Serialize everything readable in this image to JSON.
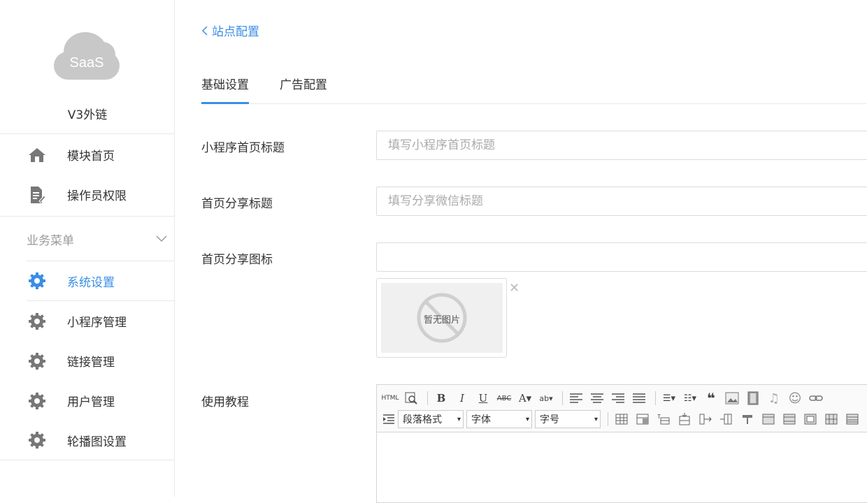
{
  "sidebar": {
    "logo_text": "SaaS",
    "site_name": "V3外链",
    "top_items": [
      {
        "label": "模块首页",
        "icon": "home-icon"
      },
      {
        "label": "操作员权限",
        "icon": "document-edit-icon"
      }
    ],
    "group": {
      "label": "业务菜单",
      "icon": "chevron-down-icon"
    },
    "items": [
      {
        "label": "系统设置",
        "icon": "gear-icon",
        "active": true
      },
      {
        "label": "小程序管理",
        "icon": "gear-icon"
      },
      {
        "label": "链接管理",
        "icon": "gear-icon"
      },
      {
        "label": "用户管理",
        "icon": "gear-icon"
      },
      {
        "label": "轮播图设置",
        "icon": "gear-icon"
      }
    ]
  },
  "main": {
    "back_label": "站点配置",
    "tabs": [
      {
        "label": "基础设置",
        "active": true
      },
      {
        "label": "广告配置"
      }
    ],
    "form": {
      "title_label": "小程序首页标题",
      "title_placeholder": "填写小程序首页标题",
      "share_title_label": "首页分享标题",
      "share_title_placeholder": "填写分享微信标题",
      "share_icon_label": "首页分享图标",
      "share_icon_value": "",
      "no_image_text": "暂无图片",
      "close_symbol": "✕",
      "tutorial_label": "使用教程"
    },
    "editor": {
      "html_label": "HTML",
      "paragraph_select": "段落格式",
      "font_select": "字体",
      "size_select": "字号"
    }
  },
  "colors": {
    "accent": "#3a8ee6",
    "icon_gray": "#777777",
    "border": "#e8e8e8"
  }
}
